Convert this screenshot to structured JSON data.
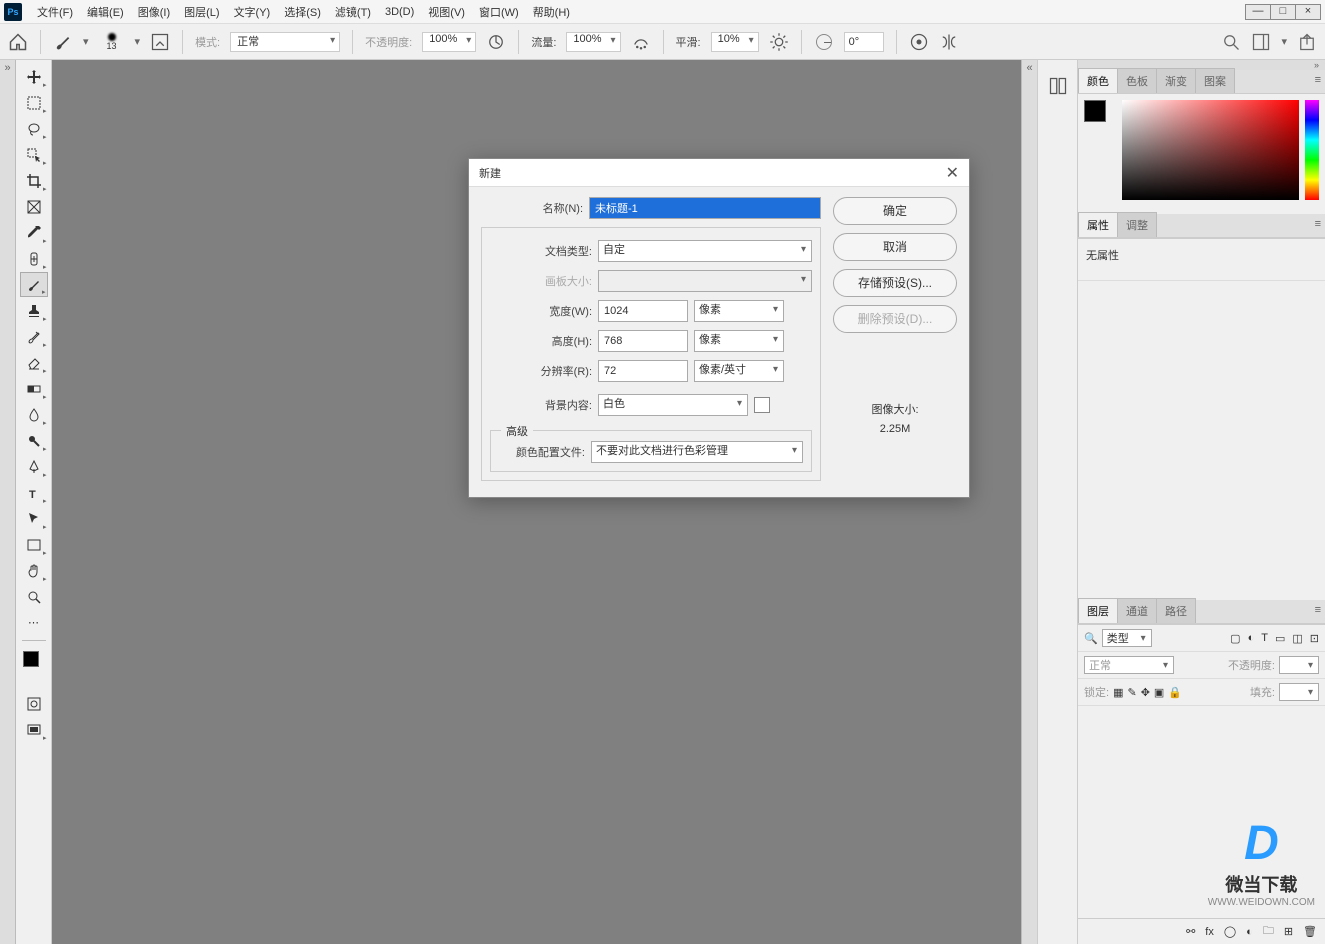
{
  "menubar": {
    "items": [
      "文件(F)",
      "编辑(E)",
      "图像(I)",
      "图层(L)",
      "文字(Y)",
      "选择(S)",
      "滤镜(T)",
      "3D(D)",
      "视图(V)",
      "窗口(W)",
      "帮助(H)"
    ]
  },
  "options": {
    "brush_size": "13",
    "mode_label": "模式:",
    "mode_value": "正常",
    "opacity_label": "不透明度:",
    "opacity_value": "100%",
    "flow_label": "流量:",
    "flow_value": "100%",
    "smoothing_label": "平滑:",
    "smoothing_value": "10%",
    "angle_value": "0°"
  },
  "dialog": {
    "title": "新建",
    "name_label": "名称(N):",
    "name_value": "未标题-1",
    "preset_label": "文档类型:",
    "preset_value": "自定",
    "artboard_label": "画板大小:",
    "width_label": "宽度(W):",
    "width_value": "1024",
    "width_unit": "像素",
    "height_label": "高度(H):",
    "height_value": "768",
    "height_unit": "像素",
    "res_label": "分辨率(R):",
    "res_value": "72",
    "res_unit": "像素/英寸",
    "bg_label": "背景内容:",
    "bg_value": "白色",
    "advanced_label": "高级",
    "profile_label": "颜色配置文件:",
    "profile_value": "不要对此文档进行色彩管理",
    "ok": "确定",
    "cancel": "取消",
    "save_preset": "存储预设(S)...",
    "delete_preset": "删除预设(D)...",
    "size_label": "图像大小:",
    "size_value": "2.25M"
  },
  "panels": {
    "color_tabs": [
      "颜色",
      "色板",
      "渐变",
      "图案"
    ],
    "prop_tabs": [
      "属性",
      "调整"
    ],
    "prop_empty": "无属性",
    "layer_tabs": [
      "图层",
      "通道",
      "路径"
    ],
    "layer_filter": "类型",
    "blend_mode": "正常",
    "opacity_label": "不透明度:",
    "lock_label": "锁定:",
    "fill_label": "填充:"
  },
  "watermark": {
    "text": "微当下载",
    "url": "WWW.WEIDOWN.COM"
  }
}
